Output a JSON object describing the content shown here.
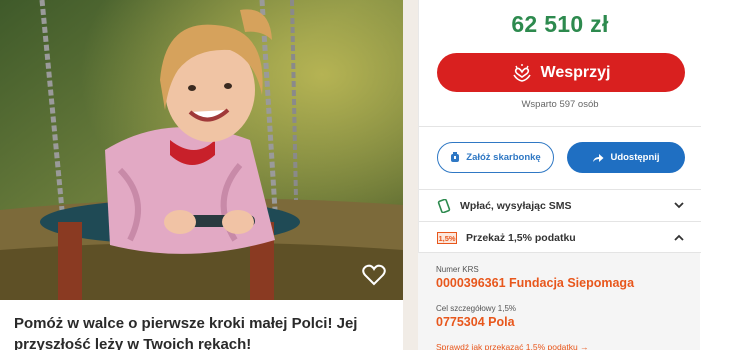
{
  "campaign": {
    "title": "Pomóż w walce o pierwsze kroki małej Polci! Jej przyszłość leży w Twoich rękach!"
  },
  "panel": {
    "amount": "62 510 zł",
    "donate_label": "Wesprzyj",
    "supported_text": "Wsparto 597 osób",
    "piggy_label": "Załóż skarbonkę",
    "share_label": "Udostępnij",
    "sms_label": "Wpłać, wysyłając SMS",
    "tax_label": "Przekaż 1,5% podatku",
    "tax_badge": "1,5%"
  },
  "tax": {
    "krs_label": "Numer KRS",
    "krs_value": "0000396361 Fundacja Siepomaga",
    "goal_label": "Cel szczegółowy 1,5%",
    "goal_value": "0775304 Pola",
    "howto_link": "Sprawdź jak przekazać 1,5% podatku →"
  },
  "colors": {
    "accent_red": "#d9201f",
    "amount_green": "#2d8a4e",
    "share_blue": "#1f6fc2",
    "tax_orange": "#e8571c"
  },
  "icons": [
    "heart-hand-icon",
    "piggy-bank-icon",
    "share-arrow-icon",
    "phone-icon",
    "chevron-down-icon",
    "chevron-up-icon",
    "heart-outline-icon"
  ]
}
